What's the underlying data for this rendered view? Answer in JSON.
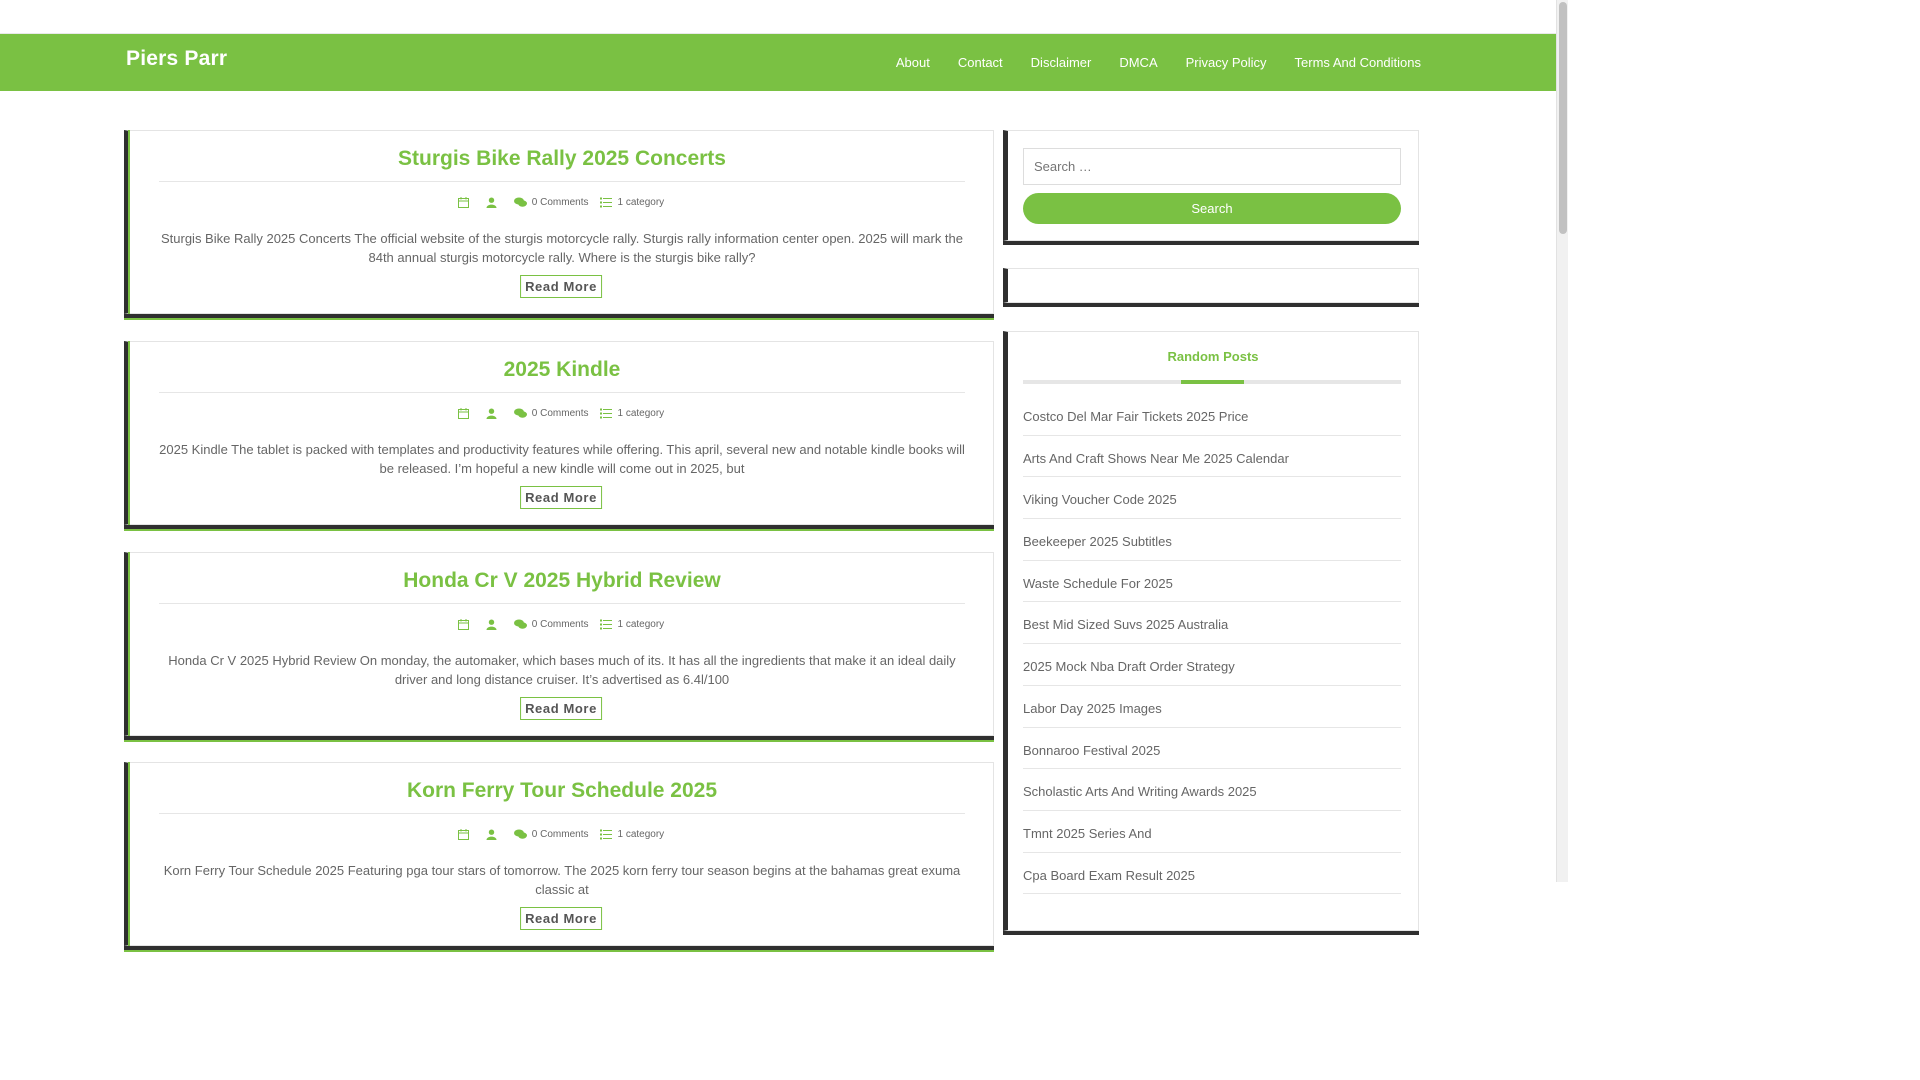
{
  "site": {
    "title": "Piers Parr"
  },
  "nav": {
    "items": [
      "About",
      "Contact",
      "Disclaimer",
      "DMCA",
      "Privacy Policy",
      "Terms And Conditions"
    ]
  },
  "colors": {
    "accent": "#7ac143",
    "dark_border": "#2f2f2f"
  },
  "posts": [
    {
      "title": "Sturgis Bike Rally 2025 Concerts",
      "comments": "0 Comments",
      "category": "1 category",
      "excerpt": "Sturgis Bike Rally 2025 Concerts The official website of the sturgis motorcycle rally. Sturgis rally information center open. 2025 will mark the 84th annual sturgis motorcycle rally. Where is the sturgis bike rally?",
      "read_more": "Read More"
    },
    {
      "title": "2025 Kindle",
      "comments": "0 Comments",
      "category": "1 category",
      "excerpt": "2025 Kindle The tablet is packed with templates and productivity features while offering. This april, several new and notable kindle books will be released. I’m hopeful a new kindle will come out in 2025, but",
      "read_more": "Read More"
    },
    {
      "title": "Honda Cr V 2025 Hybrid Review",
      "comments": "0 Comments",
      "category": "1 category",
      "excerpt": "Honda Cr V 2025 Hybrid Review On monday, the automaker, which bases much of its. It has all the ingredients that make it an ideal daily driver and long distance cruiser. It’s advertised as 6.4l/100",
      "read_more": "Read More"
    },
    {
      "title": "Korn Ferry Tour Schedule 2025",
      "comments": "0 Comments",
      "category": "1 category",
      "excerpt": "Korn Ferry Tour Schedule 2025 Featuring pga tour stars of tomorrow. The 2025 korn ferry tour season begins at the bahamas great exuma classic at",
      "read_more": "Read More"
    }
  ],
  "sidebar": {
    "search": {
      "placeholder": "Search …",
      "button_label": "Search"
    },
    "random_posts": {
      "title": "Random Posts",
      "items": [
        "Costco Del Mar Fair Tickets 2025 Price",
        "Arts And Craft Shows Near Me 2025 Calendar",
        "Viking Voucher Code 2025",
        "Beekeeper 2025 Subtitles",
        "Waste Schedule For 2025",
        "Best Mid Sized Suvs 2025 Australia",
        "2025 Mock Nba Draft Order Strategy",
        "Labor Day 2025 Images",
        "Bonnaroo Festival 2025",
        "Scholastic Arts And Writing Awards 2025",
        "Tmnt 2025 Series And",
        "Cpa Board Exam Result 2025"
      ]
    }
  }
}
